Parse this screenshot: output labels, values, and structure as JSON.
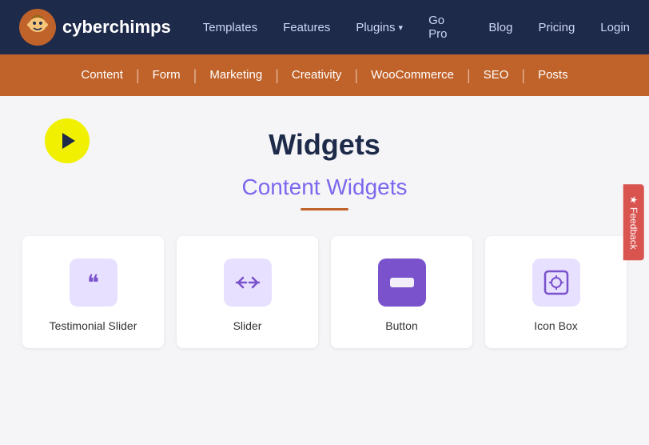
{
  "logo": {
    "text_plain": "cyber",
    "text_bold": "chimps"
  },
  "nav": {
    "links": [
      {
        "label": "Templates",
        "id": "nav-templates"
      },
      {
        "label": "Features",
        "id": "nav-features"
      },
      {
        "label": "Plugins",
        "id": "nav-plugins",
        "has_dropdown": true
      },
      {
        "label": "Go Pro",
        "id": "nav-gopro"
      },
      {
        "label": "Blog",
        "id": "nav-blog"
      },
      {
        "label": "Pricing",
        "id": "nav-pricing"
      },
      {
        "label": "Login",
        "id": "nav-login"
      }
    ]
  },
  "category_nav": {
    "items": [
      {
        "label": "Content",
        "id": "cat-content"
      },
      {
        "label": "Form",
        "id": "cat-form"
      },
      {
        "label": "Marketing",
        "id": "cat-marketing"
      },
      {
        "label": "Creativity",
        "id": "cat-creativity"
      },
      {
        "label": "WooCommerce",
        "id": "cat-woocommerce"
      },
      {
        "label": "SEO",
        "id": "cat-seo"
      },
      {
        "label": "Posts",
        "id": "cat-posts"
      }
    ]
  },
  "main": {
    "page_title": "Widgets",
    "section_title": "Content Widgets"
  },
  "widgets": [
    {
      "label": "Testimonial Slider",
      "icon": "❝",
      "icon_style": "purple-light",
      "id": "widget-testimonial"
    },
    {
      "label": "Slider",
      "icon": "⇄",
      "icon_style": "purple-light",
      "id": "widget-slider"
    },
    {
      "label": "Button",
      "icon": "▬",
      "icon_style": "purple",
      "id": "widget-button"
    },
    {
      "label": "Icon Box",
      "icon": "⊡",
      "icon_style": "purple-light",
      "id": "widget-iconbox"
    }
  ],
  "feedback": {
    "label": "Feedback"
  }
}
